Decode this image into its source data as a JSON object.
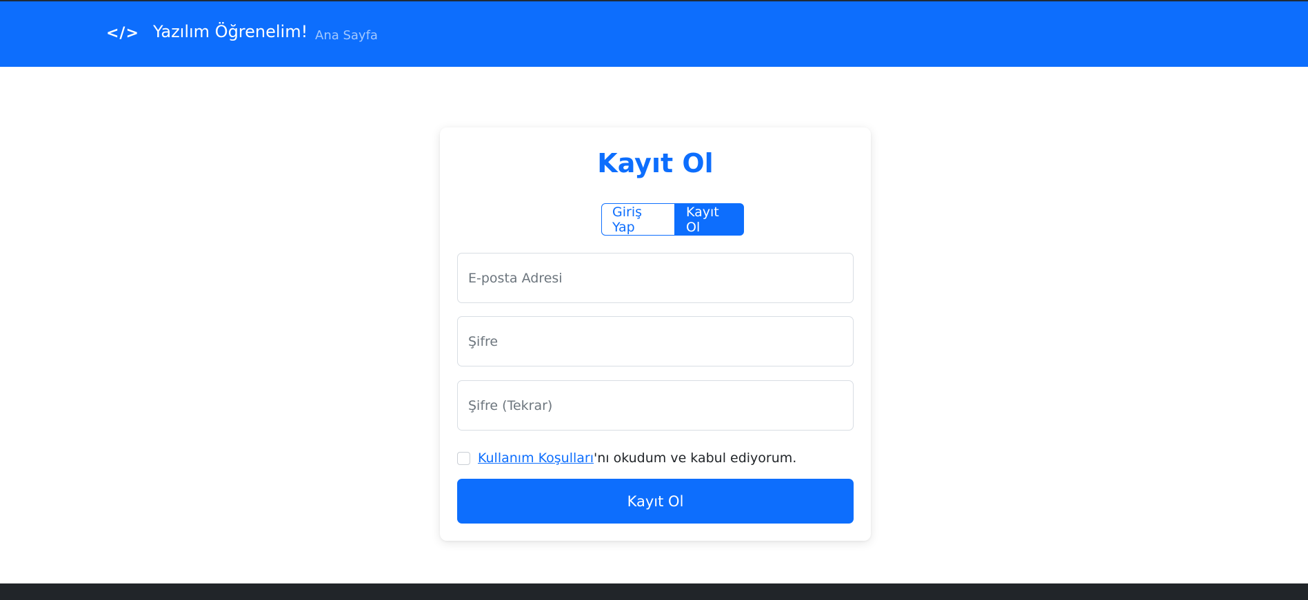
{
  "navbar": {
    "brand_icon": "</>",
    "brand_text": "Yazılım Öğrenelim!",
    "links": [
      {
        "label": "Ana Sayfa"
      }
    ]
  },
  "card": {
    "title": "Kayıt Ol",
    "toggle": {
      "login_label": "Giriş Yap",
      "register_label": "Kayıt Ol",
      "active": "Kayıt Ol"
    },
    "fields": {
      "email": {
        "placeholder": "E-posta Adresi",
        "value": ""
      },
      "password": {
        "placeholder": "Şifre",
        "value": ""
      },
      "password_repeat": {
        "placeholder": "Şifre (Tekrar)",
        "value": ""
      }
    },
    "terms": {
      "checked": false,
      "link_text": "Kullanım Koşulları",
      "suffix_text": "'nı okudum ve kabul ediyorum."
    },
    "submit_label": "Kayıt Ol"
  },
  "colors": {
    "primary": "#0d6efd",
    "footer": "#212529"
  }
}
